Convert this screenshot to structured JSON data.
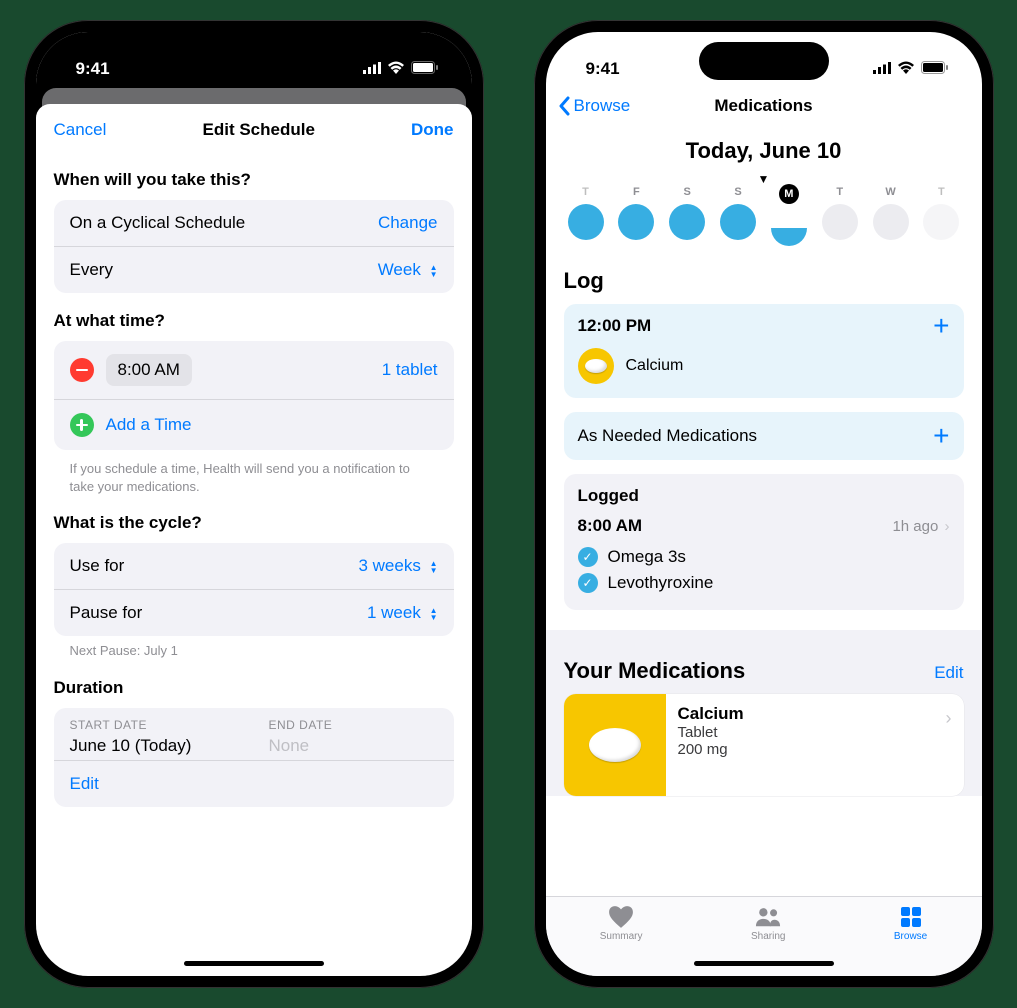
{
  "status": {
    "time": "9:41"
  },
  "phone1": {
    "nav": {
      "cancel": "Cancel",
      "title": "Edit Schedule",
      "done": "Done"
    },
    "section_when": "When will you take this?",
    "schedule": {
      "label": "On a Cyclical Schedule",
      "change": "Change",
      "every_label": "Every",
      "every_value": "Week"
    },
    "section_time": "At what time?",
    "time": {
      "value": "8:00 AM",
      "dose": "1 tablet",
      "add": "Add a Time"
    },
    "time_footnote": "If you schedule a time, Health will send you a notification to take your medications.",
    "section_cycle": "What is the cycle?",
    "cycle": {
      "use_for_label": "Use for",
      "use_for_value": "3 weeks",
      "pause_for_label": "Pause for",
      "pause_for_value": "1 week",
      "next_pause": "Next Pause: July 1"
    },
    "section_duration": "Duration",
    "duration": {
      "start_label": "START DATE",
      "start_value": "June 10 (Today)",
      "end_label": "END DATE",
      "end_value": "None",
      "edit": "Edit"
    }
  },
  "phone2": {
    "nav": {
      "back": "Browse",
      "title": "Medications"
    },
    "date_header": "Today, June 10",
    "week": {
      "letters": [
        "T",
        "F",
        "S",
        "S",
        "M",
        "T",
        "W",
        "T"
      ],
      "selected_index": 4,
      "states": [
        "edge-full",
        "full",
        "full",
        "full",
        "half-selected",
        "empty",
        "empty",
        "edge-empty"
      ]
    },
    "log_h": "Log",
    "log_time": "12:00 PM",
    "log_med": "Calcium",
    "as_needed": "As Needed Medications",
    "logged_h": "Logged",
    "logged_time": "8:00 AM",
    "logged_ago": "1h ago",
    "logged_items": [
      "Omega 3s",
      "Levothyroxine"
    ],
    "your_meds_h": "Your Medications",
    "your_meds_edit": "Edit",
    "ym_name": "Calcium",
    "ym_form": "Tablet",
    "ym_strength": "200 mg",
    "tabs": {
      "summary": "Summary",
      "sharing": "Sharing",
      "browse": "Browse"
    }
  }
}
